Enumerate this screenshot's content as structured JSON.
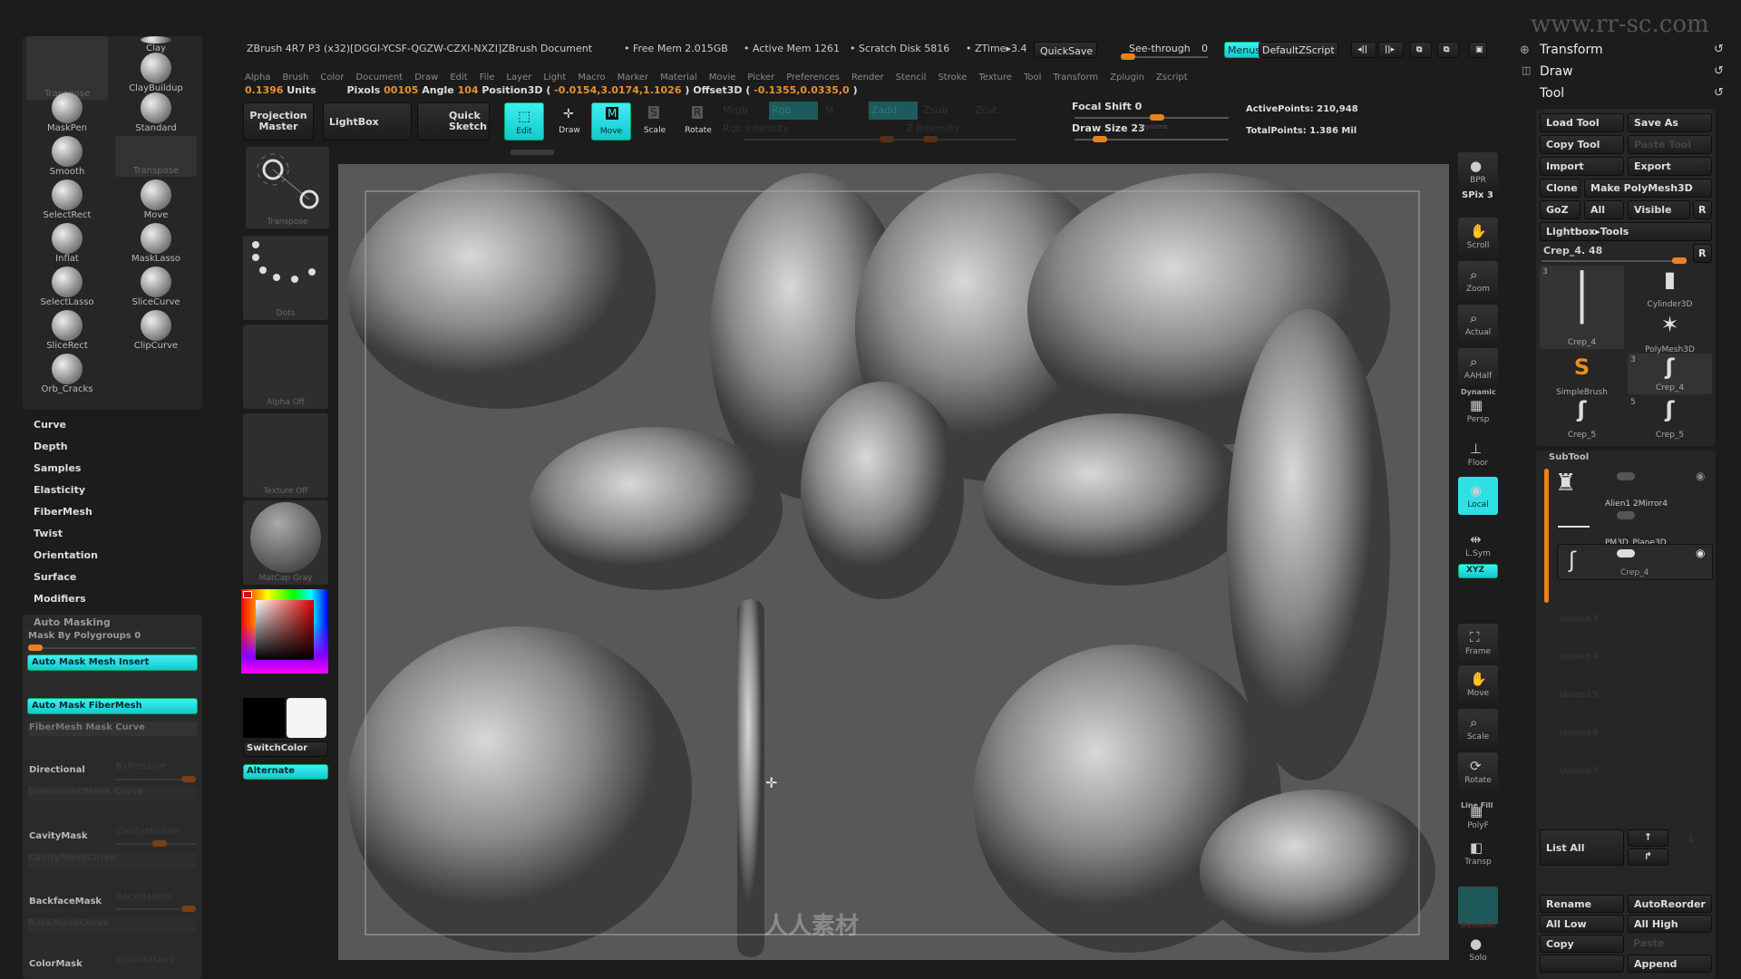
{
  "titlebar": {
    "title": "ZBrush 4R7 P3 (x32)[DGGI-YCSF-QGZW-CZXI-NXZI]ZBrush Document",
    "free_mem": "• Free Mem 2.015GB",
    "active_mem": "• Active Mem 1261",
    "scratch": "• Scratch Disk 5816",
    "ztime": "• ZTime▸3.4",
    "quicksave": "QuickSave",
    "see_through": "See-through",
    "see_through_value": "0",
    "see_through_level": 0,
    "menus": "Menus",
    "default_zscript": "DefaultZScript",
    "watermark": "www.rr-sc.com"
  },
  "menubar": [
    "Alpha",
    "Brush",
    "Color",
    "Document",
    "Draw",
    "Edit",
    "File",
    "Layer",
    "Light",
    "Macro",
    "Marker",
    "Material",
    "Movie",
    "Picker",
    "Preferences",
    "Render",
    "Stencil",
    "Stroke",
    "Texture",
    "Tool",
    "Transform",
    "Zplugin",
    "Zscript"
  ],
  "infobar": {
    "units_value": "0.1396",
    "units": "Units",
    "pixols_label": "Pixols",
    "pixols": "00105",
    "angle_label": "Angle",
    "angle": "104",
    "pos_label": "Position3D (",
    "pos": "-0.0154,3.0174,1.1026",
    "close1": ")",
    "offset_label": "Offset3D (",
    "offset": "-0.1355,0.0335,0",
    "close2": ")"
  },
  "toolbar": {
    "projection_master": "Projection Master",
    "lightbox": "LightBox",
    "quick_sketch": "Quick Sketch",
    "edit": "Edit",
    "draw": "Draw",
    "move": "Move",
    "scale": "Scale",
    "rotate": "Rotate",
    "mrgb": "Mrgb",
    "rgb": "Rgb",
    "m": "M",
    "zadd": "Zadd",
    "zsub": "Zsub",
    "zcut": "Zcut",
    "rgb_intensity": "Rgb Intensity",
    "z_intensity": "Z Intensity",
    "focal_shift": "Focal Shift 0",
    "draw_size": "Draw Size 23",
    "dynamic": "Dynamic",
    "active_points": "ActivePoints: 210,948",
    "total_points": "TotalPoints: 1.386 Mil",
    "focal_shift_value": 0,
    "draw_size_value": 23
  },
  "brushes": [
    {
      "label": "Transpose"
    },
    {
      "label": "Clay"
    },
    {
      "label": "ClayBuildup"
    },
    {
      "label": "MaskPen"
    },
    {
      "label": "Standard"
    },
    {
      "label": "Smooth"
    },
    {
      "label": "Transpose"
    },
    {
      "label": "SelectRect"
    },
    {
      "label": "Move"
    },
    {
      "label": "Inflat"
    },
    {
      "label": "MaskLasso"
    },
    {
      "label": "SelectLasso"
    },
    {
      "label": "SliceCurve"
    },
    {
      "label": "SliceRect"
    },
    {
      "label": "ClipCurve"
    },
    {
      "label": "Orb_Cracks"
    }
  ],
  "brush_menu": [
    "Curve",
    "Depth",
    "Samples",
    "Elasticity",
    "FiberMesh",
    "Twist",
    "Orientation",
    "Surface",
    "Modifiers"
  ],
  "automask": {
    "title": "Auto Masking",
    "mask_by_polygroups": "Mask By Polygroups 0",
    "mesh_insert": "Auto Mask Mesh Insert",
    "fibermesh": "Auto Mask FiberMesh",
    "fibermesh_curve": "FiberMesh Mask Curve",
    "directional": "Directional",
    "bypressure": "ByPressure",
    "directional_curve": "DirectionalMask Curve",
    "cavity": "CavityMask",
    "cavity_int": "CavityMaskInt",
    "cavity_curve": "CavityMaskCurve",
    "backface": "BackfaceMask",
    "back_int": "BackMaskInt",
    "back_curve": "BackMaskCurve",
    "color": "ColorMask",
    "color_int": "ColorMaskInt"
  },
  "tool_column": {
    "transpose": "Transpose",
    "dots": "Dots",
    "alpha": "Alpha Off",
    "texture": "Texture Off",
    "matcap": "MatCap Gray",
    "switch_color": "SwitchColor",
    "alternate": "Alternate",
    "main_color": "#cc1a1a",
    "secondary_color": "#ffffff"
  },
  "right_shelf": [
    {
      "label": "BPR",
      "icon": "render-icon"
    },
    {
      "label": "SPix 3",
      "icon": ""
    },
    {
      "label": "Scroll",
      "icon": "hand-icon"
    },
    {
      "label": "Zoom",
      "icon": "magnifier-icon"
    },
    {
      "label": "Actual",
      "icon": "magnifier-icon"
    },
    {
      "label": "AAHalf",
      "icon": "magnifier-icon"
    },
    {
      "label": "Persp",
      "icon": "grid-icon"
    },
    {
      "label": "Floor",
      "icon": "floor-icon"
    },
    {
      "label": "Local",
      "icon": "local-icon"
    },
    {
      "label": "L.Sym",
      "icon": "sym-icon"
    },
    {
      "label": "XYZ",
      "icon": "rotate-icon"
    },
    {
      "label": "Frame",
      "icon": "frame-icon"
    },
    {
      "label": "Move",
      "icon": "hand-icon"
    },
    {
      "label": "Scale",
      "icon": "magnifier-icon"
    },
    {
      "label": "Rotate",
      "icon": "rotate-icon"
    },
    {
      "label": "PolyF",
      "icon": "grid-icon"
    },
    {
      "label": "Transp",
      "icon": "transp-icon"
    },
    {
      "label": "Ghost",
      "icon": ""
    },
    {
      "label": "Solo",
      "icon": "solo-icon"
    }
  ],
  "right_shelf_extra": {
    "dynamic": "Dynamic",
    "linefill": "Line Fill",
    "dynamic2": "Dynamic"
  },
  "right_panel": {
    "transform": "Transform",
    "draw": "Draw",
    "tool": "Tool",
    "load_tool": "Load Tool",
    "save_as": "Save As",
    "copy_tool": "Copy Tool",
    "paste_tool": "Paste Tool",
    "import": "Import",
    "export": "Export",
    "clone": "Clone",
    "make_polymesh": "Make PolyMesh3D",
    "goz": "GoZ",
    "all": "All",
    "visible": "Visible",
    "r": "R",
    "lightbox_tools": "Lightbox▸Tools",
    "crep_slider": "Crep_4. 48",
    "tools": [
      {
        "label": "Crep_4",
        "count": "3"
      },
      {
        "label": "Cylinder3D",
        "count": ""
      },
      {
        "label": "PolyMesh3D",
        "count": ""
      },
      {
        "label": "SimpleBrush",
        "count": ""
      },
      {
        "label": "Crep_4",
        "count": "3"
      },
      {
        "label": "Crep_5",
        "count": ""
      },
      {
        "label": "Crep_5",
        "count": "5"
      }
    ],
    "subtool_title": "SubTool",
    "subtools": [
      "Alien1 2Mirror4",
      "PM3D_Plane3D",
      "Crep_4"
    ],
    "unused": [
      "Unused 3",
      "Unused 4",
      "Unused 5",
      "Unused 6",
      "Unused 7"
    ],
    "list_all": "List All",
    "rename": "Rename",
    "autoreorder": "AutoReorder",
    "all_low": "All Low",
    "all_high": "All High",
    "copy": "Copy",
    "paste": "Paste",
    "append": "Append"
  },
  "canvas": {
    "watermark": "人人素材"
  }
}
